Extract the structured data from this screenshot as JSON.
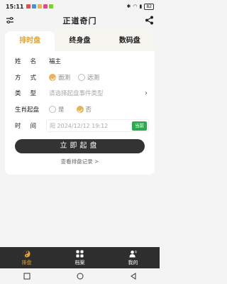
{
  "status": {
    "time": "15:11",
    "battery": "82",
    "dot_colors": [
      "#d9534f",
      "#4a90d9",
      "#f0ad4e",
      "#e04a8a",
      "#7ed321"
    ]
  },
  "header": {
    "title": "正道奇门"
  },
  "tabs": [
    {
      "label": "排时盘",
      "active": true
    },
    {
      "label": "终身盘",
      "active": false
    },
    {
      "label": "数码盘",
      "active": false
    }
  ],
  "form": {
    "name_label_1": "姓",
    "name_label_2": "名",
    "name_value": "福主",
    "mode_label_1": "方",
    "mode_label_2": "式",
    "mode_options": [
      "面测",
      "远测"
    ],
    "type_label_1": "类",
    "type_label_2": "型",
    "type_placeholder": "请选择起盘事件类型",
    "zodiac_label": "生肖起盘",
    "zodiac_options": [
      "是",
      "否"
    ],
    "time_label_1": "时",
    "time_label_2": "间",
    "time_placeholder": "阳 2024/12/12 19:12",
    "now_button": "当前"
  },
  "actions": {
    "start_button": "立即起盘",
    "records_link": "查看排盘记录 >"
  },
  "bottom_nav": [
    {
      "label": "排盘",
      "icon": "taiji-icon",
      "active": true
    },
    {
      "label": "档案",
      "icon": "grid-icon",
      "active": false
    },
    {
      "label": "我的",
      "icon": "user-icon",
      "active": false
    }
  ],
  "colors": {
    "accent": "#e0a43a",
    "dark": "#333333",
    "now_green": "#2fa84f"
  }
}
